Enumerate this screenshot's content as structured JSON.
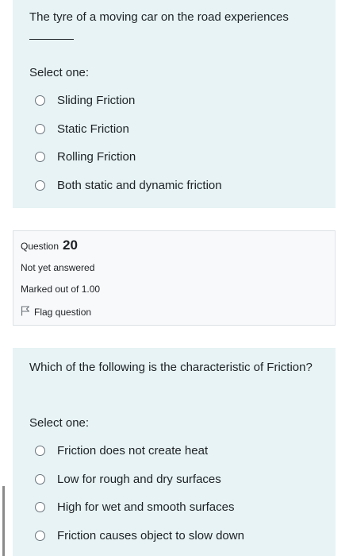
{
  "question19": {
    "text": "The tyre of a moving car on the road experiences",
    "prompt": "Select one:",
    "options": [
      "Sliding Friction",
      "Static Friction",
      "Rolling Friction",
      "Both static and dynamic friction"
    ]
  },
  "question20_info": {
    "question_word": "Question",
    "number": "20",
    "state": "Not yet answered",
    "grade": "Marked out of 1.00",
    "flag_label": "Flag question",
    "flag_icon": "flag-icon"
  },
  "question20": {
    "text": "Which of the following is  the characteristic of Friction?",
    "prompt": "Select one:",
    "options": [
      "Friction does not create heat",
      "Low for rough and dry surfaces",
      "High for wet and smooth surfaces",
      "Friction causes object to slow down"
    ]
  },
  "colors": {
    "content_bg": "#e7f3f5",
    "info_bg": "#f8f9fa",
    "text": "#1d2125"
  }
}
